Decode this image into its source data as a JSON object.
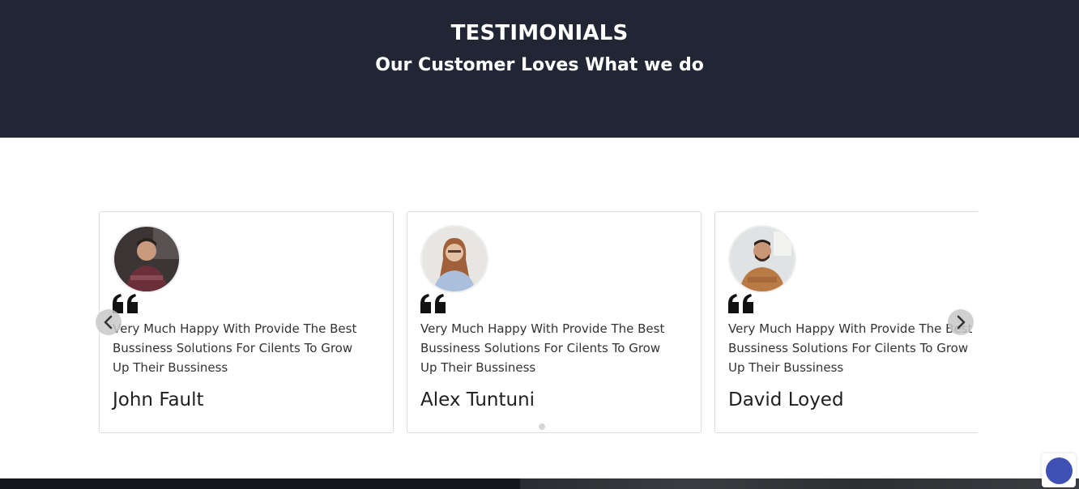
{
  "header": {
    "title": "TESTIMONIALS",
    "subtitle": "Our Customer Loves What we do"
  },
  "testimonials": [
    {
      "text": "Very Much Happy With Provide The Best Bussiness Solutions For Cilents To Grow Up Their Bussiness",
      "name": "John Fault",
      "avatar_icon": "person-photo-icon"
    },
    {
      "text": "Very Much Happy With Provide The Best Bussiness Solutions For Cilents To Grow Up Their Bussiness",
      "name": "Alex Tuntuni",
      "avatar_icon": "person-photo-icon"
    },
    {
      "text": "Very Much Happy With Provide The Best Bussiness Solutions For Cilents To Grow Up Their Bussiness",
      "name": "David Loyed",
      "avatar_icon": "person-photo-icon"
    }
  ],
  "icons": {
    "quote": "quote-icon",
    "prev": "chevron-left-icon",
    "next": "chevron-right-icon",
    "chat": "chat-bubble-icon"
  },
  "colors": {
    "hero_bg": "#222533",
    "chat_accent": "#3f51b5"
  }
}
